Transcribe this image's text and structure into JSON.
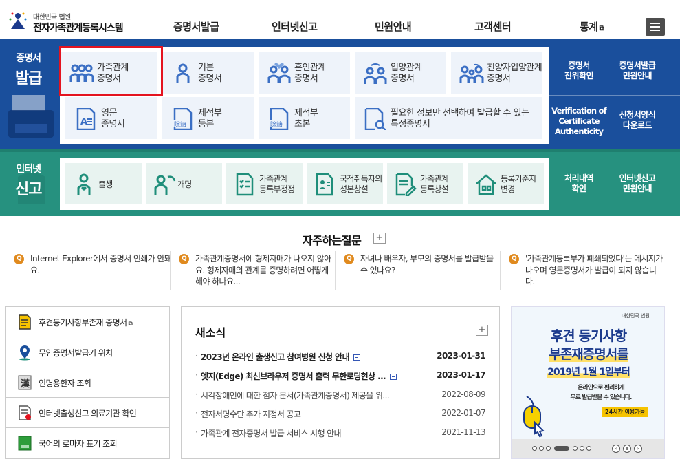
{
  "header": {
    "logo_sub": "대한민국 법원",
    "logo_name": "전자가족관계등록시스템",
    "nav": [
      "증명서발급",
      "인터넷신고",
      "민원안내",
      "고객센터",
      "통계"
    ],
    "nav_ext_icon": "external-link-icon",
    "menu_icon": "hamburger-icon"
  },
  "cert_section": {
    "title_small": "증명서",
    "title_big": "발급",
    "tiles": [
      {
        "label": "가족관계\n증명서",
        "icon": "family-icon"
      },
      {
        "label": "기본\n증명서",
        "icon": "person-icon"
      },
      {
        "label": "혼인관계\n증명서",
        "icon": "couple-heart-icon"
      },
      {
        "label": "입양관계\n증명서",
        "icon": "adoption-icon"
      },
      {
        "label": "친양자입양관계\n증명서",
        "icon": "family-adoption-icon"
      },
      {
        "label": "영문\n증명서",
        "icon": "english-doc-icon"
      },
      {
        "label": "제적부\n등본",
        "icon": "register-doc-icon"
      },
      {
        "label": "제적부\n초본",
        "icon": "register-doc-icon"
      },
      {
        "label": "필요한 정보만 선택하여 발급할 수 있는\n특정증명서",
        "icon": "search-doc-icon"
      }
    ],
    "side": [
      {
        "label": "증명서\n진위확인"
      },
      {
        "label": "증명서발급\n민원안내"
      },
      {
        "label": "Verification of\nCertificate\nAuthenticity"
      },
      {
        "label": "신청서양식\n다운로드"
      }
    ],
    "selected_tile": "가족관계\n증명서"
  },
  "report_section": {
    "title_small": "인터넷",
    "title_big": "신고",
    "tiles": [
      {
        "label": "출생",
        "icon": "birth-icon"
      },
      {
        "label": "개명",
        "icon": "rename-icon"
      },
      {
        "label": "가족관계\n등록부정정",
        "icon": "checklist-doc-icon"
      },
      {
        "label": "국적취득자의\n성본창설",
        "icon": "id-card-icon"
      },
      {
        "label": "가족관계\n등록창설",
        "icon": "edit-doc-icon"
      },
      {
        "label": "등록기준지\n변경",
        "icon": "house-icon"
      }
    ],
    "side": [
      {
        "label": "처리내역\n확인"
      },
      {
        "label": "인터넷신고\n민원안내"
      }
    ]
  },
  "faq": {
    "title": "자주하는질문",
    "more": "+",
    "badge": "Q",
    "items": [
      "Internet Explorer에서 증명서 인쇄가 안돼요.",
      "가족관계증명서에 형제자매가 나오지 않아요. 형제자매의 관계를 증명하려면 어떻게 해야 하나요...",
      "자녀나 배우자, 부모의 증명서를 발급받을 수 있나요?",
      "'가족관계등록부가 폐쇄되었다'는 메시지가 나오며 영문증명서가 발급이 되지 않습니다."
    ]
  },
  "quick_links": [
    {
      "label": "후견등기사항부존재 증명서",
      "icon": "document-icon",
      "ext": true
    },
    {
      "label": "무인증명서발급기 위치",
      "icon": "location-pin-icon",
      "ext": false
    },
    {
      "label": "인명용한자 조회",
      "icon": "hanja-book-icon",
      "ext": false
    },
    {
      "label": "인터넷출생신고 의료기관 확인",
      "icon": "hospital-doc-icon",
      "ext": false
    },
    {
      "label": "국어의 로마자 표기 조회",
      "icon": "green-book-icon",
      "ext": false
    }
  ],
  "news": {
    "title": "새소식",
    "more": "+",
    "items": [
      {
        "title": "2023년 온라인 출생신고 참여병원 신청 안내",
        "date": "2023-01-31",
        "new": true
      },
      {
        "title": "엣지(Edge) 최신브라우저 증명서 출력 무한로딩현상 ...",
        "date": "2023-01-17",
        "new": true
      },
      {
        "title": "시각장애인에 대한 점자 문서(가족관계증명서) 제공을 위...",
        "date": "2022-08-09",
        "new": false
      },
      {
        "title": "전자서명수단 추가 지정서 공고",
        "date": "2022-01-07",
        "new": false
      },
      {
        "title": "가족관계 전자증명서 발급 서비스 시행 안내",
        "date": "2021-11-13",
        "new": false
      }
    ]
  },
  "banner": {
    "logo": "대한민국 법원",
    "line1": "후견 등기사항",
    "line2": "부존재증명서를",
    "line3": "2019년 1월 1일부터",
    "line4": "온라인으로 편리하게",
    "line5": "무료 발급받을 수 있습니다.",
    "badge": "24시간 이용가능",
    "pages": 7,
    "active_page": 5
  }
}
